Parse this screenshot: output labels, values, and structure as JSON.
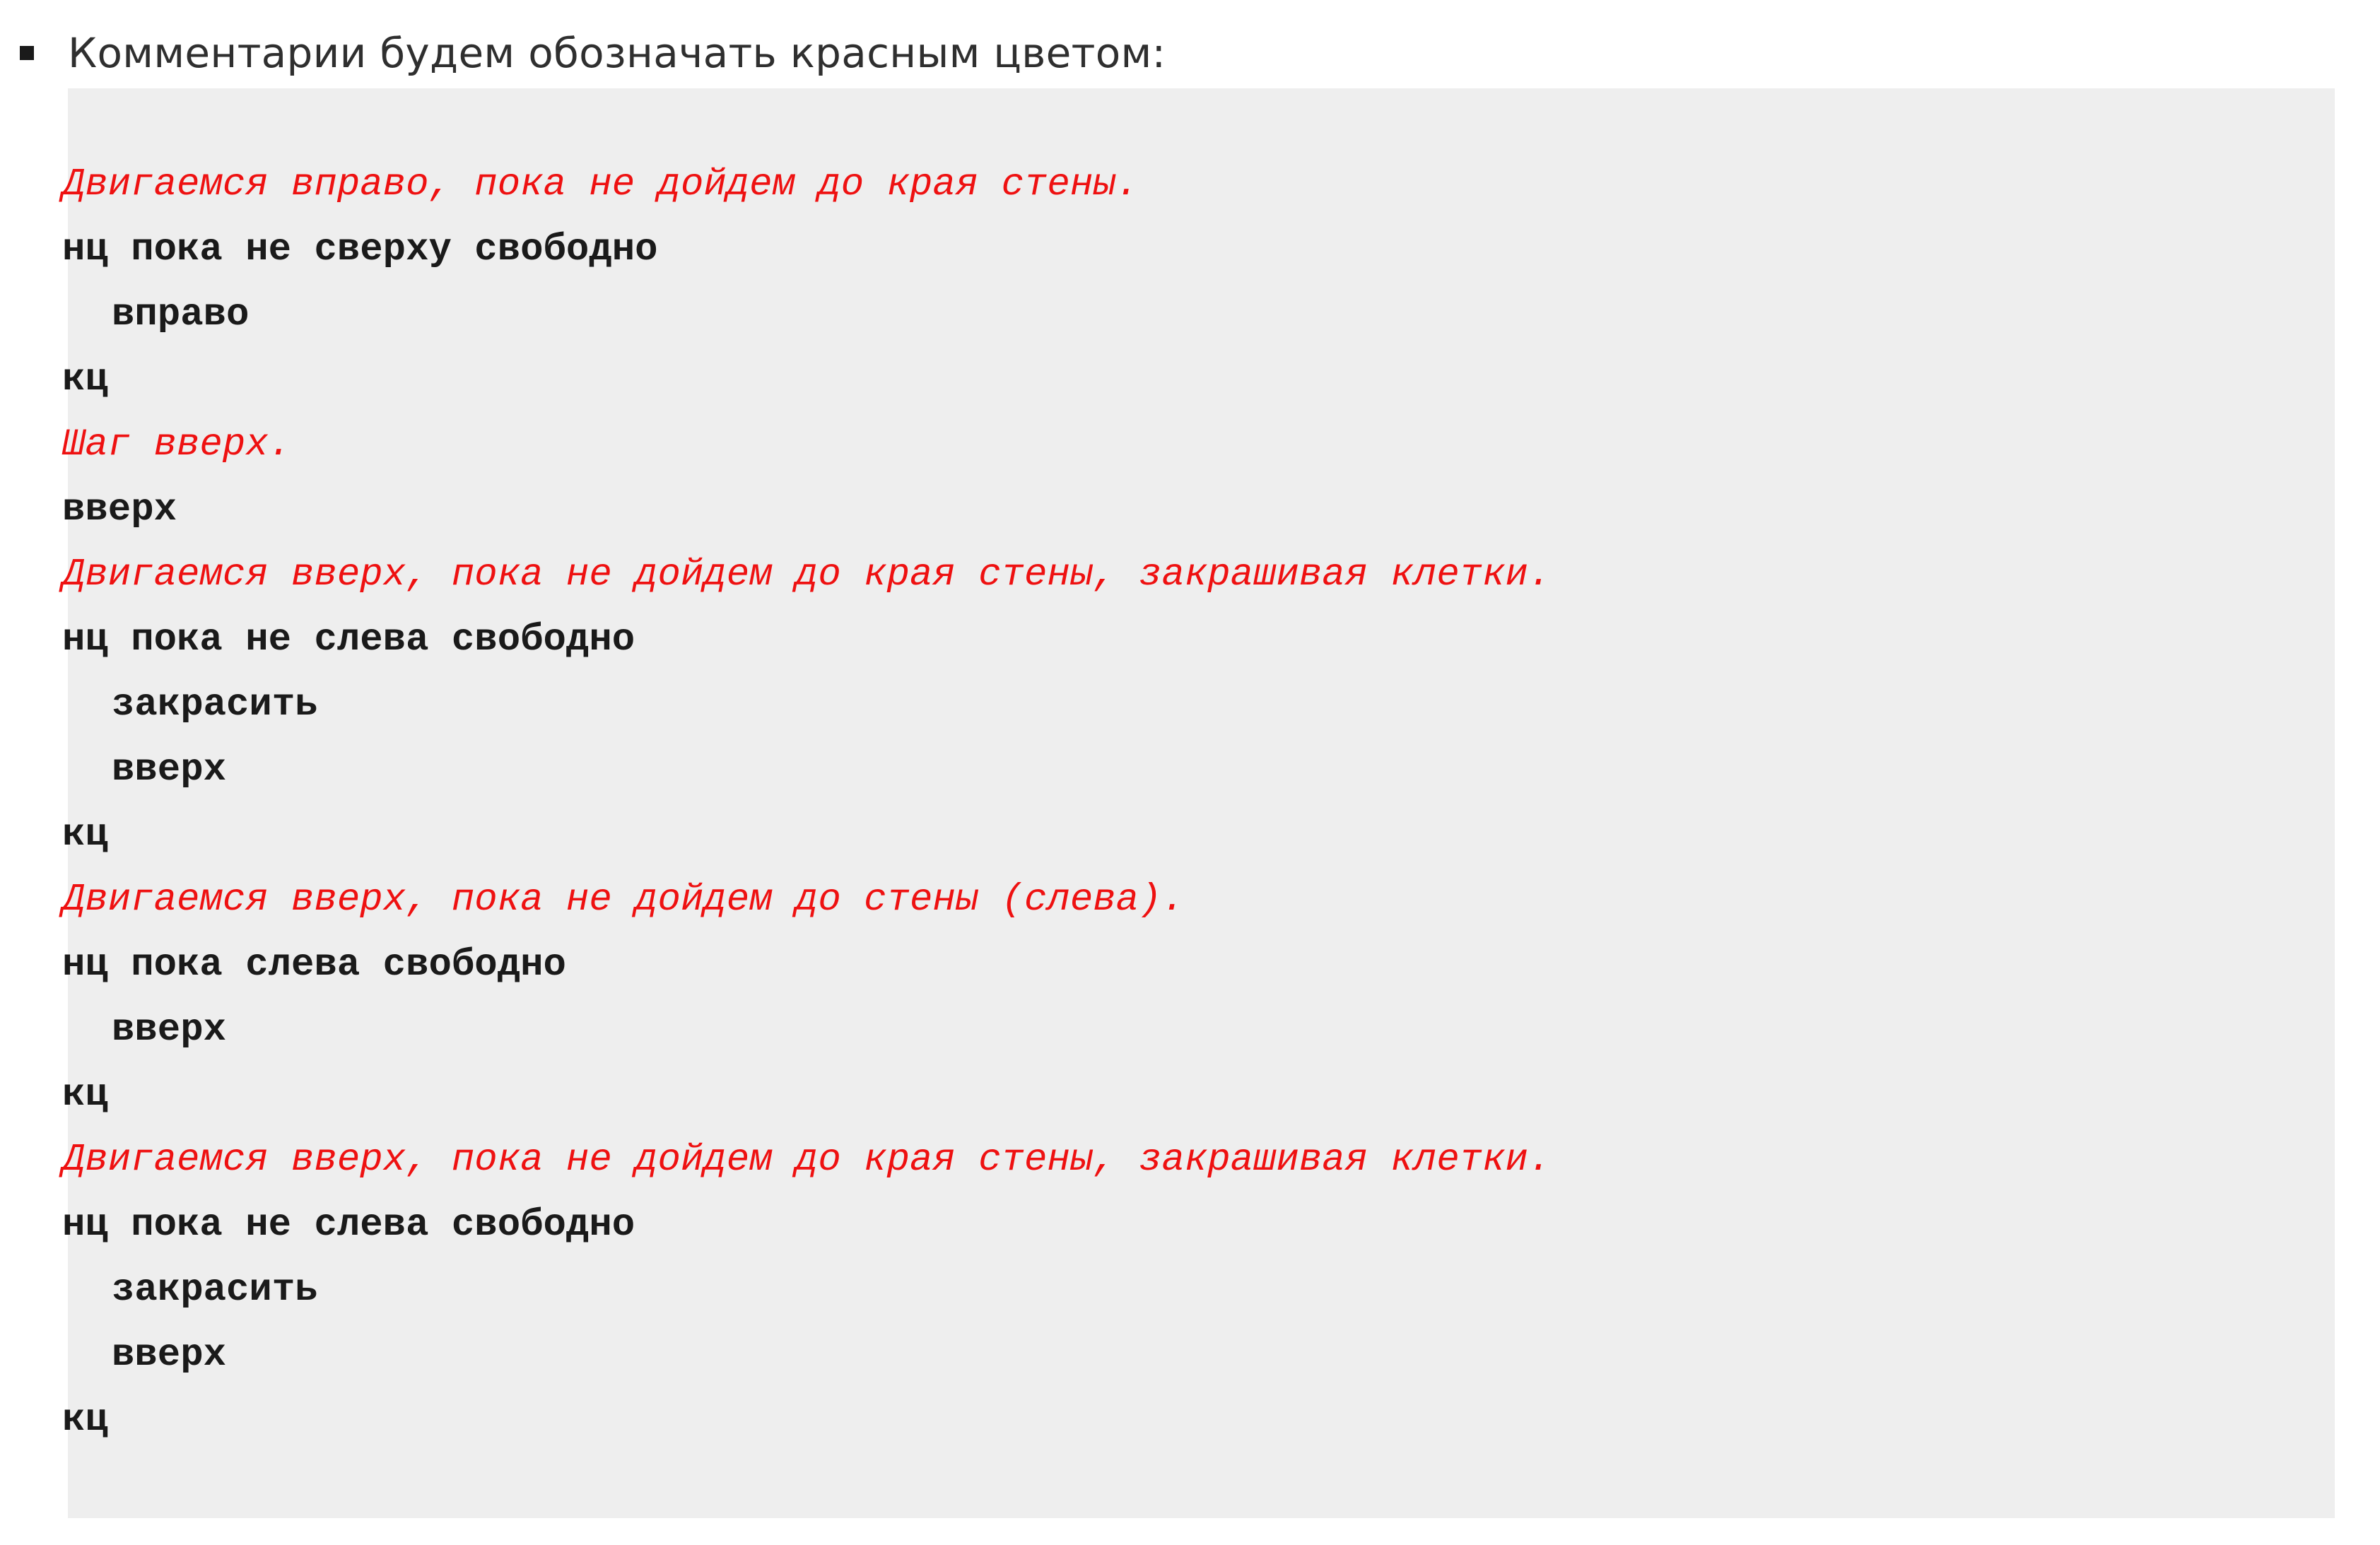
{
  "bullet": {
    "text": "Комментарии будем обозначать красным цветом:"
  },
  "colors": {
    "comment": "#ee1111",
    "code": "#1a1a1a",
    "code_background": "#eeeeee"
  },
  "code": {
    "lines": [
      {
        "kind": "comment",
        "indent": 0,
        "text": "Двигаемся вправо, пока не дойдем до края стены."
      },
      {
        "kind": "cmd",
        "indent": 0,
        "text": "нц пока не сверху свободно"
      },
      {
        "kind": "cmd",
        "indent": 1,
        "text": "вправо"
      },
      {
        "kind": "cmd",
        "indent": 0,
        "text": "кц"
      },
      {
        "kind": "comment",
        "indent": 0,
        "text": "Шаг вверх."
      },
      {
        "kind": "cmd",
        "indent": 0,
        "text": "вверх"
      },
      {
        "kind": "comment",
        "indent": 0,
        "text": "Двигаемся вверх, пока не дойдем до края стены, закрашивая клетки."
      },
      {
        "kind": "cmd",
        "indent": 0,
        "text": "нц пока не слева свободно"
      },
      {
        "kind": "cmd",
        "indent": 1,
        "text": "закрасить"
      },
      {
        "kind": "cmd",
        "indent": 1,
        "text": "вверх"
      },
      {
        "kind": "cmd",
        "indent": 0,
        "text": "кц"
      },
      {
        "kind": "comment",
        "indent": 0,
        "text": "Двигаемся вверх, пока не дойдем до стены (слева)."
      },
      {
        "kind": "cmd",
        "indent": 0,
        "text": "нц пока слева свободно"
      },
      {
        "kind": "cmd",
        "indent": 1,
        "text": "вверх"
      },
      {
        "kind": "cmd",
        "indent": 0,
        "text": "кц"
      },
      {
        "kind": "comment",
        "indent": 0,
        "text": "Двигаемся вверх, пока не дойдем до края стены, закрашивая клетки."
      },
      {
        "kind": "cmd",
        "indent": 0,
        "text": "нц пока не слева свободно"
      },
      {
        "kind": "cmd",
        "indent": 1,
        "text": "закрасить"
      },
      {
        "kind": "cmd",
        "indent": 1,
        "text": "вверх"
      },
      {
        "kind": "cmd",
        "indent": 0,
        "text": "кц"
      }
    ]
  }
}
